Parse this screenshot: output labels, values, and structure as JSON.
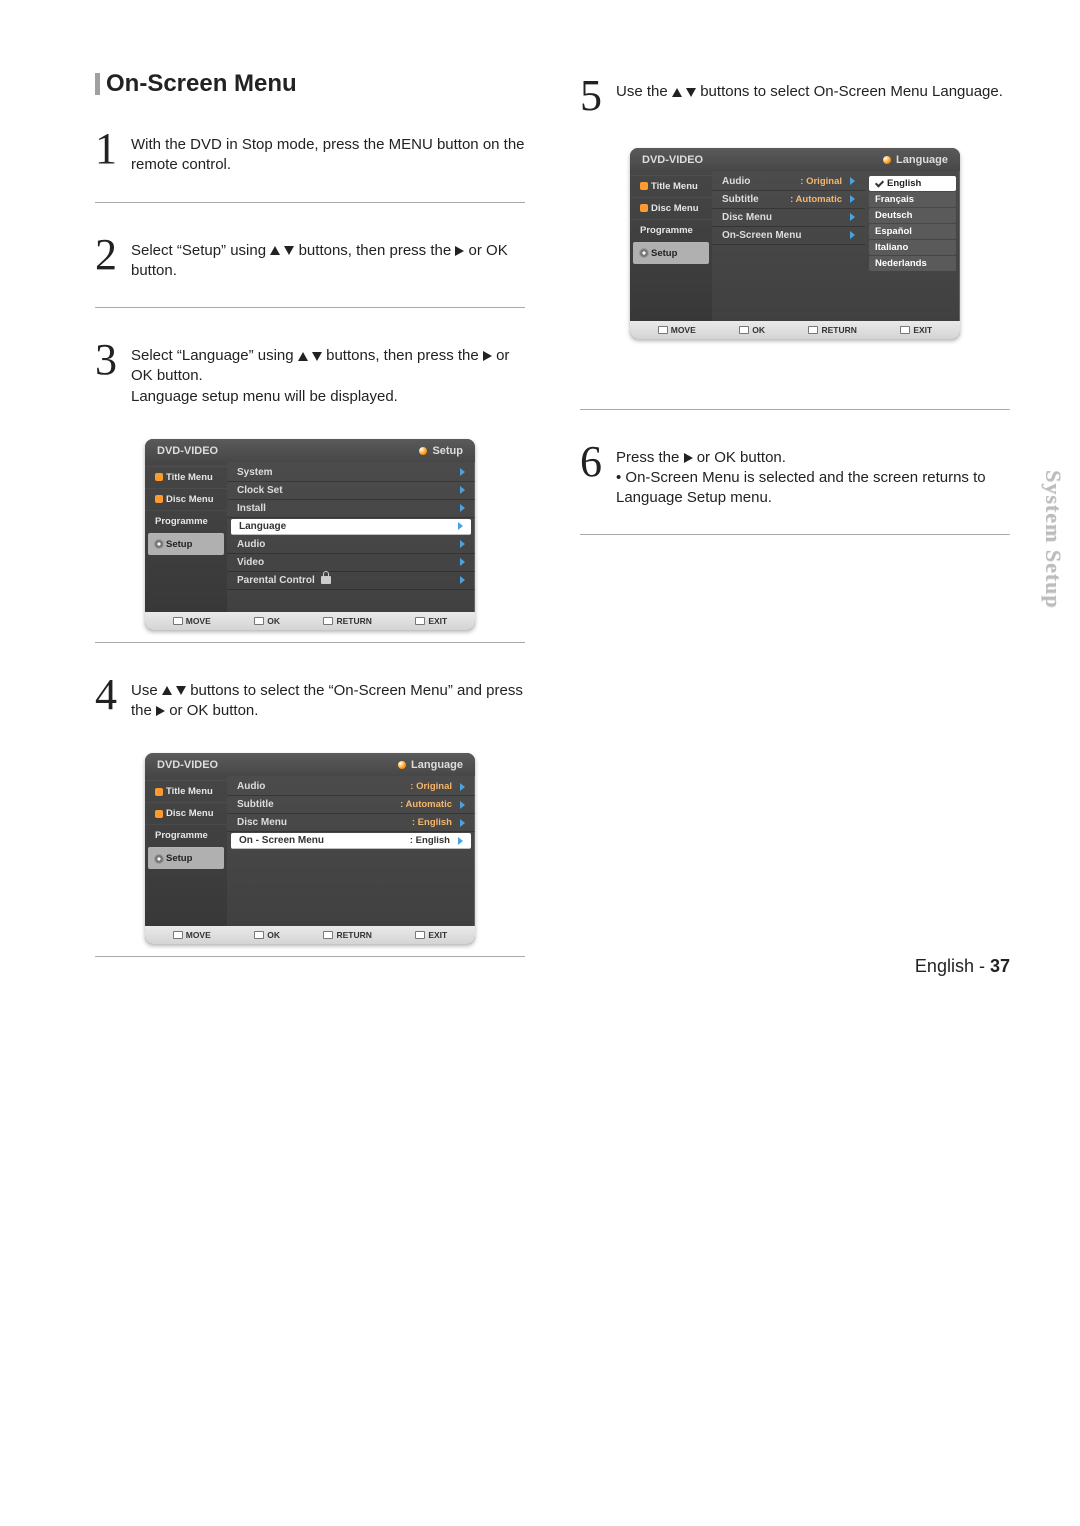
{
  "section_title": "On-Screen Menu",
  "side_tab": "System Setup",
  "footer": {
    "lang": "English",
    "sep": " - ",
    "page": "37"
  },
  "steps": {
    "1": {
      "num": "1",
      "text": "With the DVD in Stop mode, press the MENU button on the remote control."
    },
    "2": {
      "num": "2",
      "text_a": "Select “Setup” using ",
      "text_b": " buttons, then press the ",
      "text_c": " or OK button."
    },
    "3": {
      "num": "3",
      "text_a": "Select “Language” using ",
      "text_b": " buttons, then press the ",
      "text_c": " or OK button.",
      "text_d": "Language setup menu will be displayed."
    },
    "4": {
      "num": "4",
      "text_a": "Use ",
      "text_b": " buttons to select the “On-Screen Menu” and press the ",
      "text_c": " or OK button."
    },
    "5": {
      "num": "5",
      "text_a": "Use the ",
      "text_b": " buttons to select On-Screen Menu Language."
    },
    "6": {
      "num": "6",
      "text_a": "Press the ",
      "text_b": " or OK button.",
      "bullet": "• On-Screen Menu is selected and the screen returns to Language Setup menu."
    }
  },
  "osd_common": {
    "title": "DVD-VIDEO",
    "sidebar": [
      "Title Menu",
      "Disc Menu",
      "Programme",
      "Setup"
    ],
    "footer": [
      "MOVE",
      "OK",
      "RETURN",
      "EXIT"
    ]
  },
  "osd3": {
    "corner": "Setup",
    "rows": [
      {
        "label": "System"
      },
      {
        "label": "Clock Set"
      },
      {
        "label": "Install"
      },
      {
        "label": "Language",
        "hl": true
      },
      {
        "label": "Audio"
      },
      {
        "label": "Video"
      },
      {
        "label": "Parental Control",
        "lock": true
      }
    ]
  },
  "osd4": {
    "corner": "Language",
    "rows": [
      {
        "label": "Audio",
        "val": ": Original"
      },
      {
        "label": "Subtitle",
        "val": ": Automatic"
      },
      {
        "label": "Disc Menu",
        "val": ": English"
      },
      {
        "label": "On - Screen Menu",
        "val": ": English",
        "hl": true
      }
    ]
  },
  "osd5": {
    "corner": "Language",
    "rows": [
      {
        "label": "Audio",
        "val": ": Original"
      },
      {
        "label": "Subtitle",
        "val": ": Automatic"
      },
      {
        "label": "Disc Menu"
      },
      {
        "label": "On-Screen Menu"
      }
    ],
    "options": [
      "English",
      "Français",
      "Deutsch",
      "Español",
      "Italiano",
      "Nederlands"
    ]
  }
}
